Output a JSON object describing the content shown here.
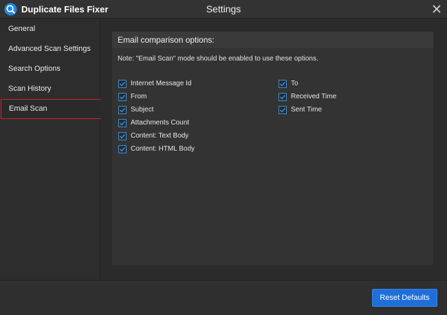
{
  "app": {
    "name": "Duplicate Files Fixer",
    "window_title": "Settings"
  },
  "sidebar": {
    "items": [
      {
        "label": "General"
      },
      {
        "label": "Advanced Scan Settings"
      },
      {
        "label": "Search Options"
      },
      {
        "label": "Scan History"
      },
      {
        "label": "Email Scan",
        "active": true
      }
    ]
  },
  "panel": {
    "title": "Email comparison options:",
    "note": "Note: \"Email Scan\" mode should be enabled to use these options.",
    "left_options": [
      {
        "label": "Internet Message Id",
        "checked": true
      },
      {
        "label": "From",
        "checked": true
      },
      {
        "label": "Subject",
        "checked": true
      },
      {
        "label": "Attachments Count",
        "checked": true
      },
      {
        "label": "Content: Text Body",
        "checked": true
      },
      {
        "label": "Content: HTML Body",
        "checked": true
      }
    ],
    "right_options": [
      {
        "label": "To",
        "checked": true
      },
      {
        "label": "Received Time",
        "checked": true
      },
      {
        "label": "Sent Time",
        "checked": true
      }
    ]
  },
  "footer": {
    "reset_label": "Reset Defaults"
  },
  "colors": {
    "accent": "#1f6fd9",
    "active_border": "#d0232e",
    "checkbox": "#3a8fd8"
  }
}
